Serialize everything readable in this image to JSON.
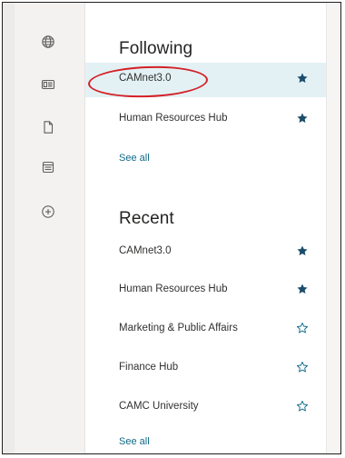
{
  "nav_rail": {
    "icons": [
      "globe-icon",
      "news-icon",
      "document-icon",
      "list-icon",
      "add-circle-icon"
    ]
  },
  "following": {
    "title": "Following",
    "items": [
      {
        "label": "CAMnet3.0",
        "starred": true,
        "selected": true
      },
      {
        "label": "Human Resources Hub",
        "starred": true
      }
    ],
    "see_all": "See all"
  },
  "recent": {
    "title": "Recent",
    "items": [
      {
        "label": "CAMnet3.0",
        "starred": true
      },
      {
        "label": "Human Resources Hub",
        "starred": true
      },
      {
        "label": "Marketing & Public Affairs",
        "starred": false
      },
      {
        "label": "Finance Hub",
        "starred": false
      },
      {
        "label": "CAMC University",
        "starred": false
      }
    ],
    "see_all": "See all"
  },
  "colors": {
    "accent": "#0f6a89",
    "star_fill": "#1b4d6b",
    "selected_row": "#e3f1f5",
    "annotation": "#d42026"
  }
}
